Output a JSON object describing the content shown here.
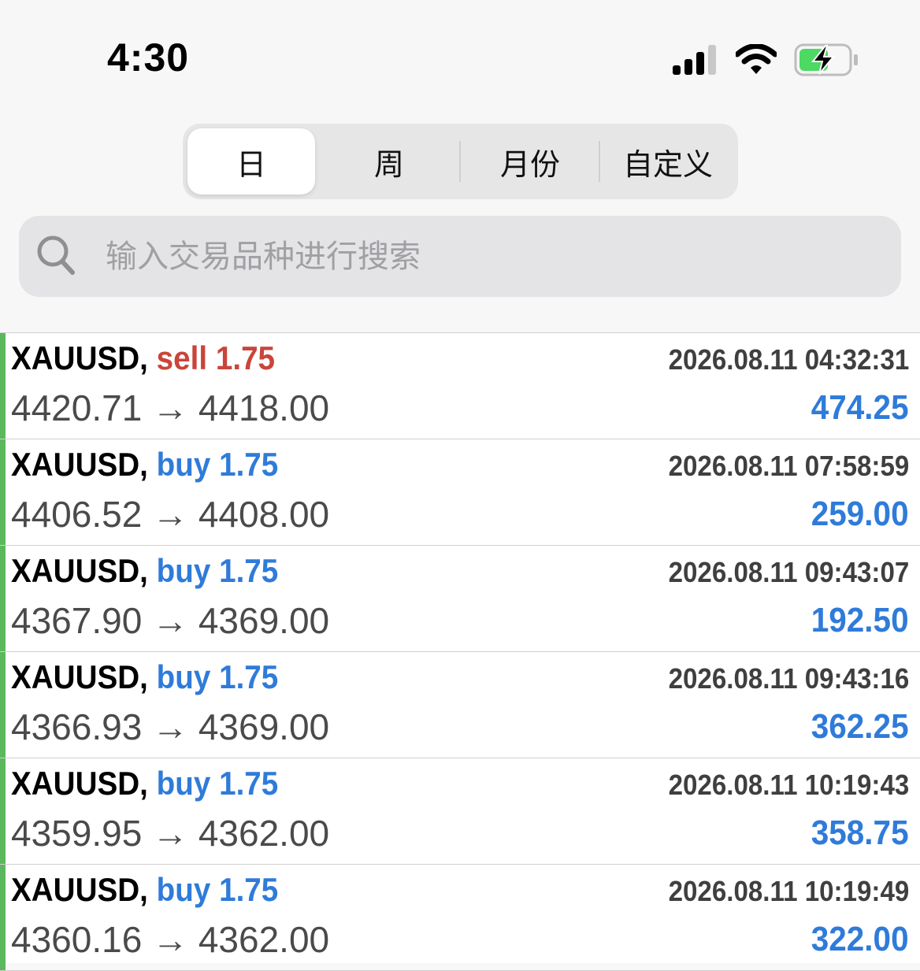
{
  "status_bar": {
    "time": "4:30"
  },
  "tabs": [
    {
      "label": "日"
    },
    {
      "label": "周"
    },
    {
      "label": "月份"
    },
    {
      "label": "自定义"
    }
  ],
  "search": {
    "placeholder": "输入交易品种进行搜索"
  },
  "trades": [
    {
      "symbol": "XAUUSD,",
      "side": "sell",
      "volume": "1.75",
      "time": "2026.08.11 04:32:31",
      "open": "4420.71",
      "arrow": "→",
      "close": "4418.00",
      "profit": "474.25"
    },
    {
      "symbol": "XAUUSD,",
      "side": "buy",
      "volume": "1.75",
      "time": "2026.08.11 07:58:59",
      "open": "4406.52",
      "arrow": "→",
      "close": "4408.00",
      "profit": "259.00"
    },
    {
      "symbol": "XAUUSD,",
      "side": "buy",
      "volume": "1.75",
      "time": "2026.08.11 09:43:07",
      "open": "4367.90",
      "arrow": "→",
      "close": "4369.00",
      "profit": "192.50"
    },
    {
      "symbol": "XAUUSD,",
      "side": "buy",
      "volume": "1.75",
      "time": "2026.08.11 09:43:16",
      "open": "4366.93",
      "arrow": "→",
      "close": "4369.00",
      "profit": "362.25"
    },
    {
      "symbol": "XAUUSD,",
      "side": "buy",
      "volume": "1.75",
      "time": "2026.08.11 10:19:43",
      "open": "4359.95",
      "arrow": "→",
      "close": "4362.00",
      "profit": "358.75"
    },
    {
      "symbol": "XAUUSD,",
      "side": "buy",
      "volume": "1.75",
      "time": "2026.08.11 10:19:49",
      "open": "4360.16",
      "arrow": "→",
      "close": "4362.00",
      "profit": "322.00"
    }
  ],
  "colors": {
    "sell": "#c9453a",
    "buy": "#2f7bd9",
    "marker": "#5cb85c"
  }
}
